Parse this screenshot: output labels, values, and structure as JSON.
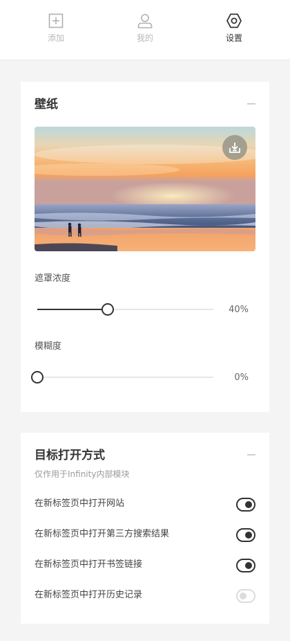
{
  "nav": {
    "items": [
      {
        "label": "添加",
        "icon": "plus-square-icon",
        "active": false
      },
      {
        "label": "我的",
        "icon": "user-icon",
        "active": false
      },
      {
        "label": "设置",
        "icon": "hexagon-gear-icon",
        "active": true
      }
    ]
  },
  "wallpaper": {
    "title": "壁纸",
    "download_icon": "download-icon",
    "mask": {
      "label": "遮罩浓度",
      "value": 40,
      "display": "40%"
    },
    "blur": {
      "label": "模糊度",
      "value": 0,
      "display": "0%"
    }
  },
  "target": {
    "title": "目标打开方式",
    "subtitle": "仅作用于Infinity内部模块",
    "options": [
      {
        "label": "在新标签页中打开网站",
        "enabled": true
      },
      {
        "label": "在新标签页中打开第三方搜索结果",
        "enabled": true
      },
      {
        "label": "在新标签页中打开书签链接",
        "enabled": true
      },
      {
        "label": "在新标签页中打开历史记录",
        "enabled": false
      }
    ]
  },
  "colors": {
    "background": "#f4f4f4",
    "card": "#ffffff",
    "text": "#333333",
    "muted": "#b8b8b8",
    "accent": "#333333"
  }
}
